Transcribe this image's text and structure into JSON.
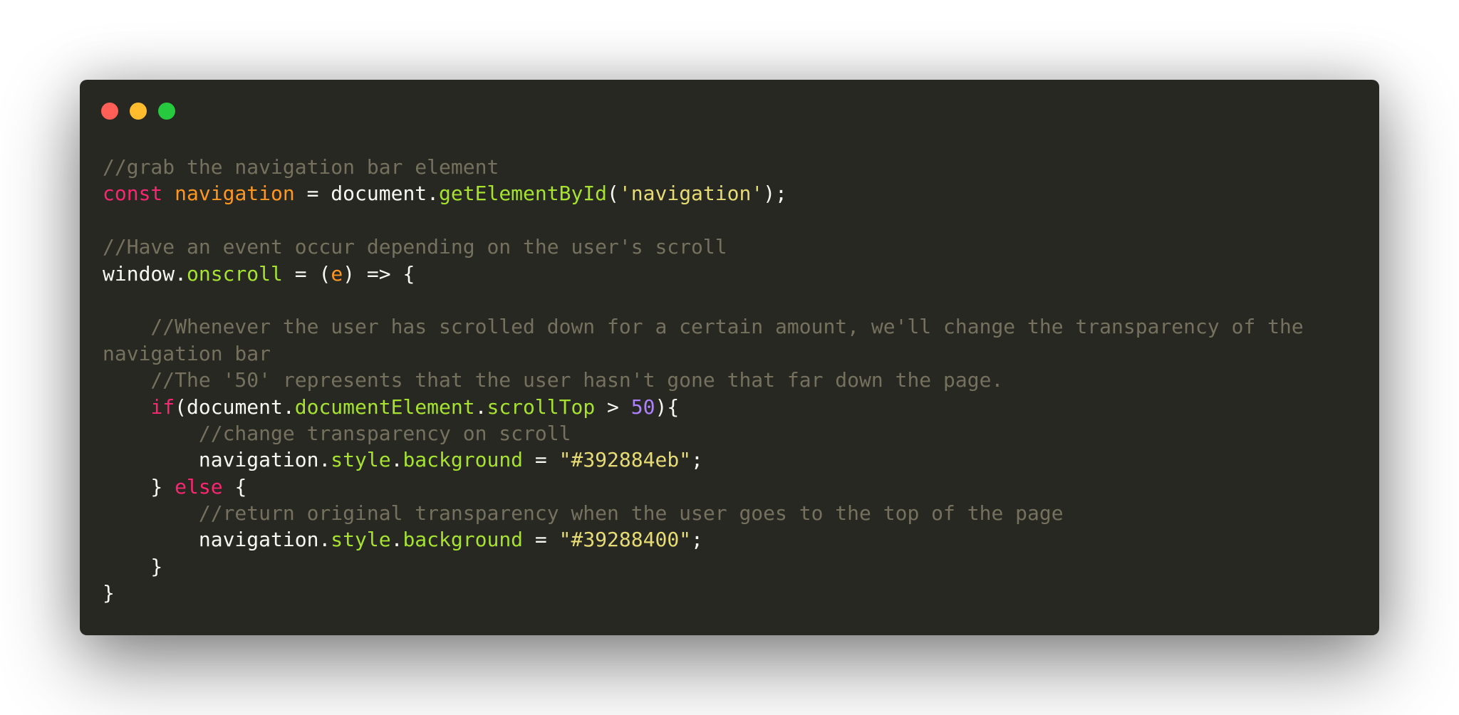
{
  "window": {
    "controls": [
      {
        "name": "close",
        "color": "#ff5f56"
      },
      {
        "name": "minimize",
        "color": "#ffbd2e"
      },
      {
        "name": "zoom",
        "color": "#27c93f"
      }
    ]
  },
  "theme": {
    "background": "#272822",
    "comment": "#75715e",
    "plain": "#f8f8f2",
    "keyword": "#f92672",
    "variable": "#fd971f",
    "function": "#a6e22e",
    "string": "#e6db74",
    "number": "#ae81ff"
  },
  "code": {
    "lines": [
      [
        {
          "t": "//grab the navigation bar element",
          "c": "comment"
        }
      ],
      [
        {
          "t": "const",
          "c": "keyword"
        },
        {
          "t": " ",
          "c": "plain"
        },
        {
          "t": "navigation",
          "c": "var"
        },
        {
          "t": " = document.",
          "c": "plain"
        },
        {
          "t": "getElementById",
          "c": "func"
        },
        {
          "t": "(",
          "c": "plain"
        },
        {
          "t": "'navigation'",
          "c": "string"
        },
        {
          "t": ");",
          "c": "plain"
        }
      ],
      [],
      [
        {
          "t": "//Have an event occur depending on the user's scroll",
          "c": "comment"
        }
      ],
      [
        {
          "t": "window.",
          "c": "plain"
        },
        {
          "t": "onscroll",
          "c": "func"
        },
        {
          "t": " = (",
          "c": "plain"
        },
        {
          "t": "e",
          "c": "var"
        },
        {
          "t": ") => {",
          "c": "plain"
        }
      ],
      [],
      [
        {
          "t": "    //Whenever the user has scrolled down for a certain amount, we'll change the transparency of the",
          "c": "comment"
        }
      ],
      [
        {
          "t": "navigation bar",
          "c": "comment"
        }
      ],
      [
        {
          "t": "    //The '50' represents that the user hasn't gone that far down the page.",
          "c": "comment"
        }
      ],
      [
        {
          "t": "    ",
          "c": "plain"
        },
        {
          "t": "if",
          "c": "keyword"
        },
        {
          "t": "(document.",
          "c": "plain"
        },
        {
          "t": "documentElement",
          "c": "func"
        },
        {
          "t": ".",
          "c": "plain"
        },
        {
          "t": "scrollTop",
          "c": "func"
        },
        {
          "t": " > ",
          "c": "plain"
        },
        {
          "t": "50",
          "c": "number"
        },
        {
          "t": "){",
          "c": "plain"
        }
      ],
      [
        {
          "t": "        //change transparency on scroll",
          "c": "comment"
        }
      ],
      [
        {
          "t": "        navigation.",
          "c": "plain"
        },
        {
          "t": "style",
          "c": "func"
        },
        {
          "t": ".",
          "c": "plain"
        },
        {
          "t": "background",
          "c": "func"
        },
        {
          "t": " = ",
          "c": "plain"
        },
        {
          "t": "\"#392884eb\"",
          "c": "string"
        },
        {
          "t": ";",
          "c": "plain"
        }
      ],
      [
        {
          "t": "    } ",
          "c": "plain"
        },
        {
          "t": "else",
          "c": "keyword"
        },
        {
          "t": " {",
          "c": "plain"
        }
      ],
      [
        {
          "t": "        //return original transparency when the user goes to the top of the page",
          "c": "comment"
        }
      ],
      [
        {
          "t": "        navigation.",
          "c": "plain"
        },
        {
          "t": "style",
          "c": "func"
        },
        {
          "t": ".",
          "c": "plain"
        },
        {
          "t": "background",
          "c": "func"
        },
        {
          "t": " = ",
          "c": "plain"
        },
        {
          "t": "\"#39288400\"",
          "c": "string"
        },
        {
          "t": ";",
          "c": "plain"
        }
      ],
      [
        {
          "t": "    }",
          "c": "plain"
        }
      ],
      [
        {
          "t": "}",
          "c": "plain"
        }
      ]
    ]
  }
}
